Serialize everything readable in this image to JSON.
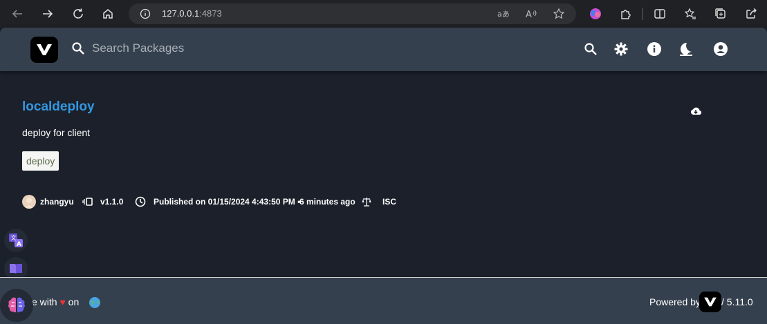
{
  "browser": {
    "url_host": "127.0.0.1",
    "url_port": ":4873"
  },
  "header": {
    "search_placeholder": "Search Packages"
  },
  "package": {
    "name": "localdeploy",
    "description": "deploy for client",
    "keywords": [
      "deploy"
    ],
    "author": "zhangyu",
    "version": "v1.1.0",
    "published": "Published on 01/15/2024 4:43:50 PM •",
    "published_ago": "6 minutes ago",
    "license": "ISC"
  },
  "footer": {
    "made_with_prefix": "e with",
    "made_with_suffix": "on",
    "heart": "♥",
    "powered_by": "Powered by",
    "version": "/ 5.11.0"
  },
  "colors": {
    "accent": "#3497e0",
    "header_bg": "#35404e",
    "page_bg": "#1b202a"
  }
}
